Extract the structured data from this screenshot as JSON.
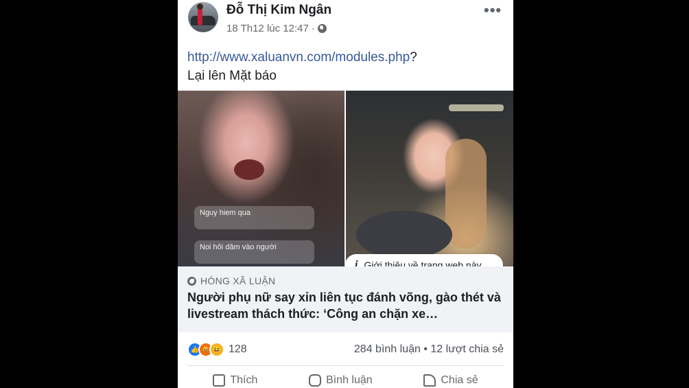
{
  "post": {
    "author": "Đỗ Thị Kim Ngân",
    "timestamp": "18 Th12 lúc 12:47",
    "separator": "·",
    "privacy_icon": "globe-icon",
    "more_label": "•••",
    "link_text": "http://www.xaluanvn.com/modules.php",
    "link_suffix": "?",
    "body_text": "Lại lên Mặt báo"
  },
  "media": {
    "left_captions": [
      "Nguy hiem qua",
      "Noi hôi dâm vào người"
    ],
    "info_badge_icon": "i",
    "info_badge_label": "Giới thiệu về trang web này"
  },
  "link_preview": {
    "source": "HÓNG XÃ LUẬN",
    "headline": "Người phụ nữ say xỉn liên tục đánh võng, gào thét và livestream thách thức: ‘Công an chặn xe…"
  },
  "reactions": {
    "count": "128",
    "colors": {
      "like": "#1877f2",
      "angry": "#e9710f",
      "haha": "#f7b125"
    }
  },
  "engagement": {
    "comments": "284 bình luận",
    "dot": "•",
    "shares": "12 lượt chia sẻ"
  },
  "actions": {
    "like_label": "Thích",
    "comment_label": "Bình luận",
    "share_label": "Chia sẻ"
  }
}
